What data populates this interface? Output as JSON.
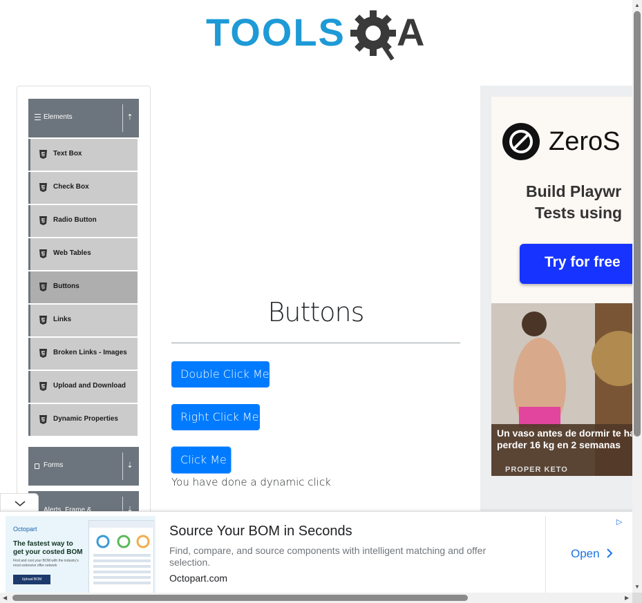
{
  "logo": {
    "text_left": "TOOLS",
    "text_right": "A",
    "colors": {
      "tools": "#1e9ad6",
      "qa": "#3a3a3a"
    }
  },
  "sidebar": {
    "elements_group": {
      "label": "Elements",
      "toggle_icon": "arrow-up-icon"
    },
    "items": [
      {
        "label": "Text Box"
      },
      {
        "label": "Check Box"
      },
      {
        "label": "Radio Button"
      },
      {
        "label": "Web Tables"
      },
      {
        "label": "Buttons",
        "active": true
      },
      {
        "label": "Links"
      },
      {
        "label": "Broken Links - Images"
      },
      {
        "label": "Upload and Download"
      },
      {
        "label": "Dynamic Properties"
      }
    ],
    "forms_group": {
      "label": "Forms"
    },
    "alerts_group": {
      "label": "Alerts, Frame &"
    }
  },
  "main": {
    "title": "Buttons",
    "double_click_label": "Double Click Me",
    "right_click_label": "Right Click Me",
    "click_label": "Click Me",
    "message": "You have done a dynamic click"
  },
  "right_ad": {
    "brand": "ZeroS",
    "line1": "Build Playwr",
    "line2": "Tests using",
    "cta": "Try for free",
    "promo_line1": "Un vaso antes de dormir te ha",
    "promo_line2": "perder 16 kg en 2 semanas",
    "promo_brand": "PROPER KETO"
  },
  "bottom_ad": {
    "image_brand": "Octopart",
    "image_headline_1": "The fastest way to",
    "image_headline_2": "get your costed BOM",
    "image_small": "Find and cost your BOM with the industry's most extensive offer network",
    "image_button": "Upload BOM",
    "title": "Source Your BOM in Seconds",
    "description": "Find, compare, and source components with intelligent matching and offer selection.",
    "url": "Octopart.com",
    "open_label": "Open"
  },
  "colors": {
    "primary": "#007bff",
    "sidebar_header": "#6c757d",
    "sidebar_item": "#cbcbcb",
    "sidebar_item_active": "#aeaeae"
  }
}
